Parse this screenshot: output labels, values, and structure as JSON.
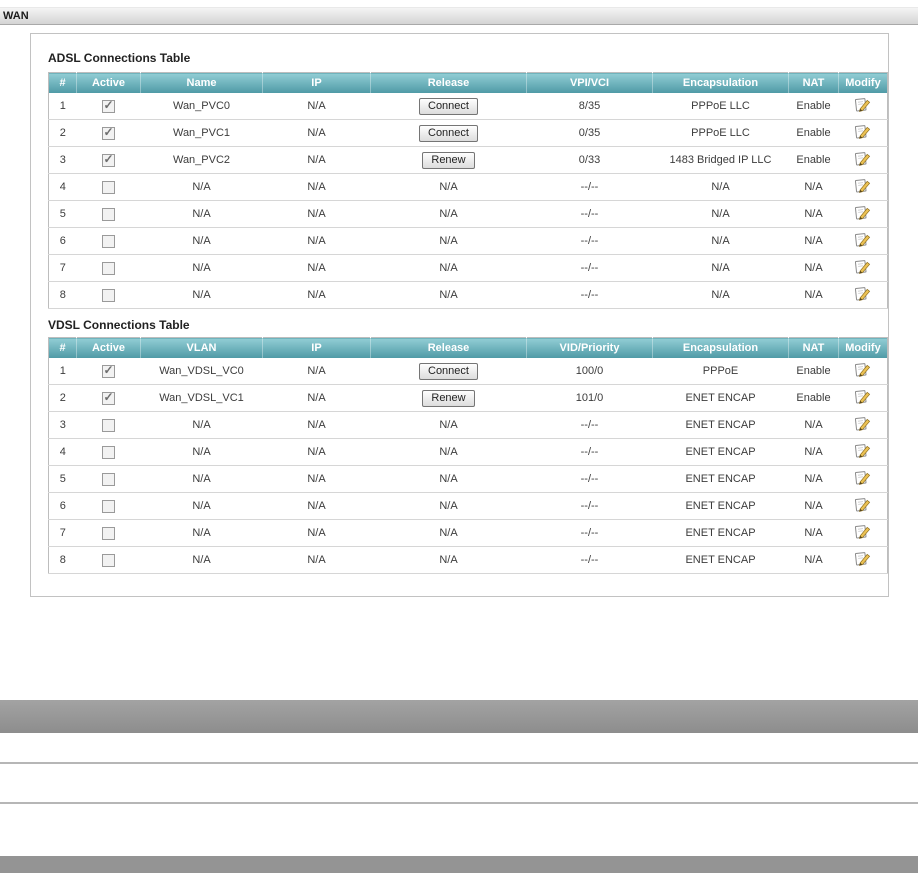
{
  "titlebar": {
    "title": "WAN"
  },
  "colors": {
    "titlebar_top": "#f4f4f4",
    "titlebar_bottom": "#d4d4d4",
    "table_header_top": "#92ced5",
    "table_header_bottom": "#4e99a5",
    "band_gray": "#949494"
  },
  "adsl": {
    "title": "ADSL Connections Table",
    "headers": [
      "#",
      "Active",
      "Name",
      "IP",
      "Release",
      "VPI/VCI",
      "Encapsulation",
      "NAT",
      "Modify"
    ],
    "rows": [
      {
        "num": "1",
        "active": true,
        "name": "Wan_PVC0",
        "ip": "N/A",
        "release": {
          "type": "button",
          "label": "Connect"
        },
        "key": "8/35",
        "encapsulation": "PPPoE LLC",
        "nat": "Enable"
      },
      {
        "num": "2",
        "active": true,
        "name": "Wan_PVC1",
        "ip": "N/A",
        "release": {
          "type": "button",
          "label": "Connect"
        },
        "key": "0/35",
        "encapsulation": "PPPoE LLC",
        "nat": "Enable"
      },
      {
        "num": "3",
        "active": true,
        "name": "Wan_PVC2",
        "ip": "N/A",
        "release": {
          "type": "button",
          "label": "Renew"
        },
        "key": "0/33",
        "encapsulation": "1483 Bridged IP LLC",
        "nat": "Enable"
      },
      {
        "num": "4",
        "active": false,
        "name": "N/A",
        "ip": "N/A",
        "release": {
          "type": "text",
          "label": "N/A"
        },
        "key": "--/--",
        "encapsulation": "N/A",
        "nat": "N/A"
      },
      {
        "num": "5",
        "active": false,
        "name": "N/A",
        "ip": "N/A",
        "release": {
          "type": "text",
          "label": "N/A"
        },
        "key": "--/--",
        "encapsulation": "N/A",
        "nat": "N/A"
      },
      {
        "num": "6",
        "active": false,
        "name": "N/A",
        "ip": "N/A",
        "release": {
          "type": "text",
          "label": "N/A"
        },
        "key": "--/--",
        "encapsulation": "N/A",
        "nat": "N/A"
      },
      {
        "num": "7",
        "active": false,
        "name": "N/A",
        "ip": "N/A",
        "release": {
          "type": "text",
          "label": "N/A"
        },
        "key": "--/--",
        "encapsulation": "N/A",
        "nat": "N/A"
      },
      {
        "num": "8",
        "active": false,
        "name": "N/A",
        "ip": "N/A",
        "release": {
          "type": "text",
          "label": "N/A"
        },
        "key": "--/--",
        "encapsulation": "N/A",
        "nat": "N/A"
      }
    ]
  },
  "vdsl": {
    "title": "VDSL Connections Table",
    "headers": [
      "#",
      "Active",
      "VLAN",
      "IP",
      "Release",
      "VID/Priority",
      "Encapsulation",
      "NAT",
      "Modify"
    ],
    "rows": [
      {
        "num": "1",
        "active": true,
        "name": "Wan_VDSL_VC0",
        "ip": "N/A",
        "release": {
          "type": "button",
          "label": "Connect"
        },
        "key": "100/0",
        "encapsulation": "PPPoE",
        "nat": "Enable"
      },
      {
        "num": "2",
        "active": true,
        "name": "Wan_VDSL_VC1",
        "ip": "N/A",
        "release": {
          "type": "button",
          "label": "Renew"
        },
        "key": "101/0",
        "encapsulation": "ENET ENCAP",
        "nat": "Enable"
      },
      {
        "num": "3",
        "active": false,
        "name": "N/A",
        "ip": "N/A",
        "release": {
          "type": "text",
          "label": "N/A"
        },
        "key": "--/--",
        "encapsulation": "ENET ENCAP",
        "nat": "N/A"
      },
      {
        "num": "4",
        "active": false,
        "name": "N/A",
        "ip": "N/A",
        "release": {
          "type": "text",
          "label": "N/A"
        },
        "key": "--/--",
        "encapsulation": "ENET ENCAP",
        "nat": "N/A"
      },
      {
        "num": "5",
        "active": false,
        "name": "N/A",
        "ip": "N/A",
        "release": {
          "type": "text",
          "label": "N/A"
        },
        "key": "--/--",
        "encapsulation": "ENET ENCAP",
        "nat": "N/A"
      },
      {
        "num": "6",
        "active": false,
        "name": "N/A",
        "ip": "N/A",
        "release": {
          "type": "text",
          "label": "N/A"
        },
        "key": "--/--",
        "encapsulation": "ENET ENCAP",
        "nat": "N/A"
      },
      {
        "num": "7",
        "active": false,
        "name": "N/A",
        "ip": "N/A",
        "release": {
          "type": "text",
          "label": "N/A"
        },
        "key": "--/--",
        "encapsulation": "ENET ENCAP",
        "nat": "N/A"
      },
      {
        "num": "8",
        "active": false,
        "name": "N/A",
        "ip": "N/A",
        "release": {
          "type": "text",
          "label": "N/A"
        },
        "key": "--/--",
        "encapsulation": "ENET ENCAP",
        "nat": "N/A"
      }
    ]
  }
}
